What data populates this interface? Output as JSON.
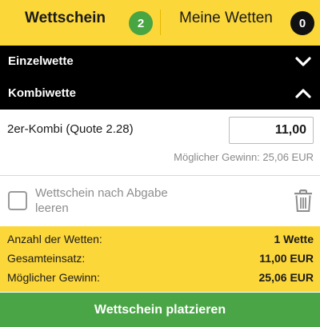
{
  "tabs": {
    "betslip": {
      "label": "Wettschein",
      "count": "2"
    },
    "my_bets": {
      "label": "Meine Wetten",
      "count": "0"
    }
  },
  "sections": {
    "single": {
      "label": "Einzelwette",
      "icon": "chevron-down-icon",
      "expanded": false
    },
    "combo": {
      "label": "Kombiwette",
      "icon": "chevron-up-icon",
      "expanded": true
    }
  },
  "bet": {
    "title": "2er-Kombi (Quote 2.28)",
    "stake": "11,00",
    "possible_win": "Möglicher Gewinn: 25,06 EUR"
  },
  "options": {
    "clear_after_submit": "Wettschein nach Abgabe leeren",
    "checked": false
  },
  "summary": {
    "rows": [
      {
        "label": "Anzahl der Wetten:",
        "value": "1 Wette"
      },
      {
        "label": "Gesamteinsatz:",
        "value": "11,00 EUR"
      },
      {
        "label": "Möglicher Gewinn:",
        "value": "25,06 EUR"
      }
    ]
  },
  "actions": {
    "place_bet": "Wettschein platzieren"
  },
  "colors": {
    "accent_yellow": "#fcd73a",
    "section_black": "#000000",
    "badge_green": "#47a542",
    "button_green": "#4aa546"
  }
}
